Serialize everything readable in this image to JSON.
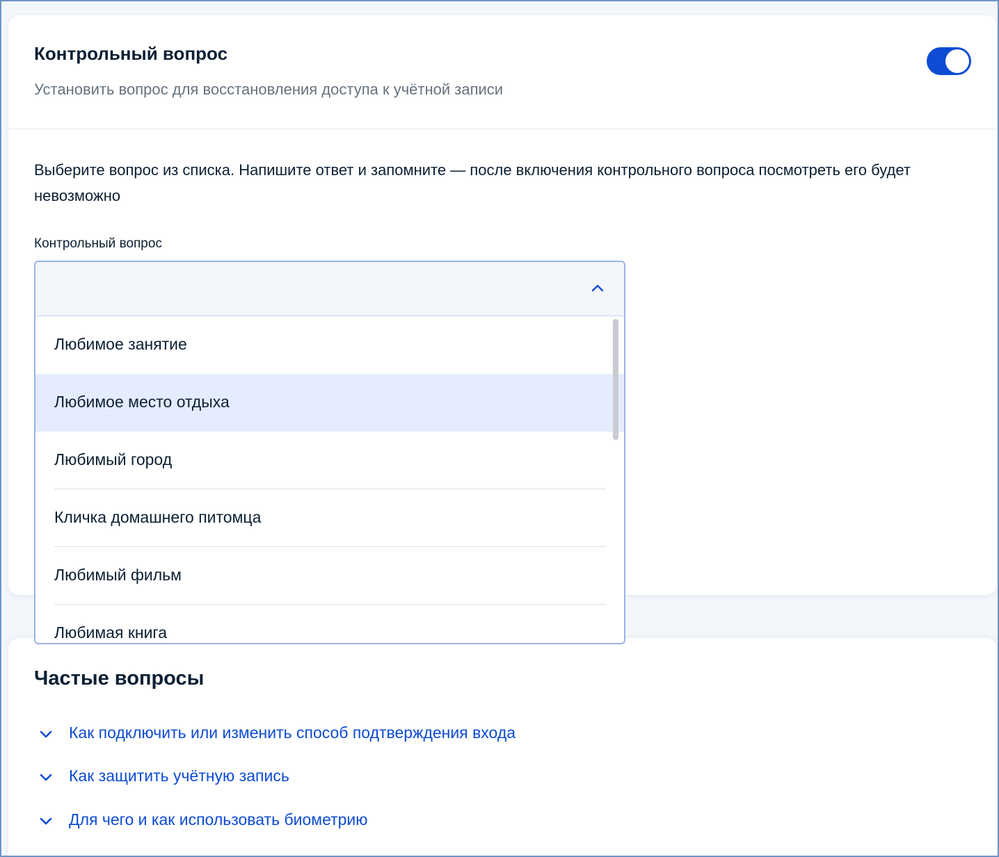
{
  "security_question": {
    "title": "Контрольный вопрос",
    "subtitle": "Установить вопрос для восстановления доступа к учётной записи",
    "toggle_on": true,
    "description": "Выберите вопрос из списка. Напишите ответ и запомните — после включения контрольного вопроса посмотреть его будет невозможно",
    "field_label": "Контрольный вопрос",
    "selected_value": "",
    "options": [
      {
        "label": "Любимое занятие",
        "highlighted": false
      },
      {
        "label": "Любимое место отдыха",
        "highlighted": true
      },
      {
        "label": "Любимый город",
        "highlighted": false
      },
      {
        "label": "Кличка домашнего питомца",
        "highlighted": false
      },
      {
        "label": "Любимый фильм",
        "highlighted": false
      },
      {
        "label": "Любимая книга",
        "highlighted": false
      }
    ]
  },
  "faq": {
    "title": "Частые вопросы",
    "items": [
      {
        "label": "Как подключить или изменить способ подтверждения входа"
      },
      {
        "label": "Как защитить учётную запись"
      },
      {
        "label": "Для чего и как использовать биометрию"
      }
    ]
  },
  "colors": {
    "accent": "#0d4cd3",
    "text_primary": "#0b1f33",
    "text_secondary": "#66727f",
    "highlight": "#e4ecfd",
    "frame_border": "#6f95c4"
  },
  "icons": {
    "select_chevron": "chevron-up-icon",
    "faq_chevron": "chevron-down-icon"
  }
}
